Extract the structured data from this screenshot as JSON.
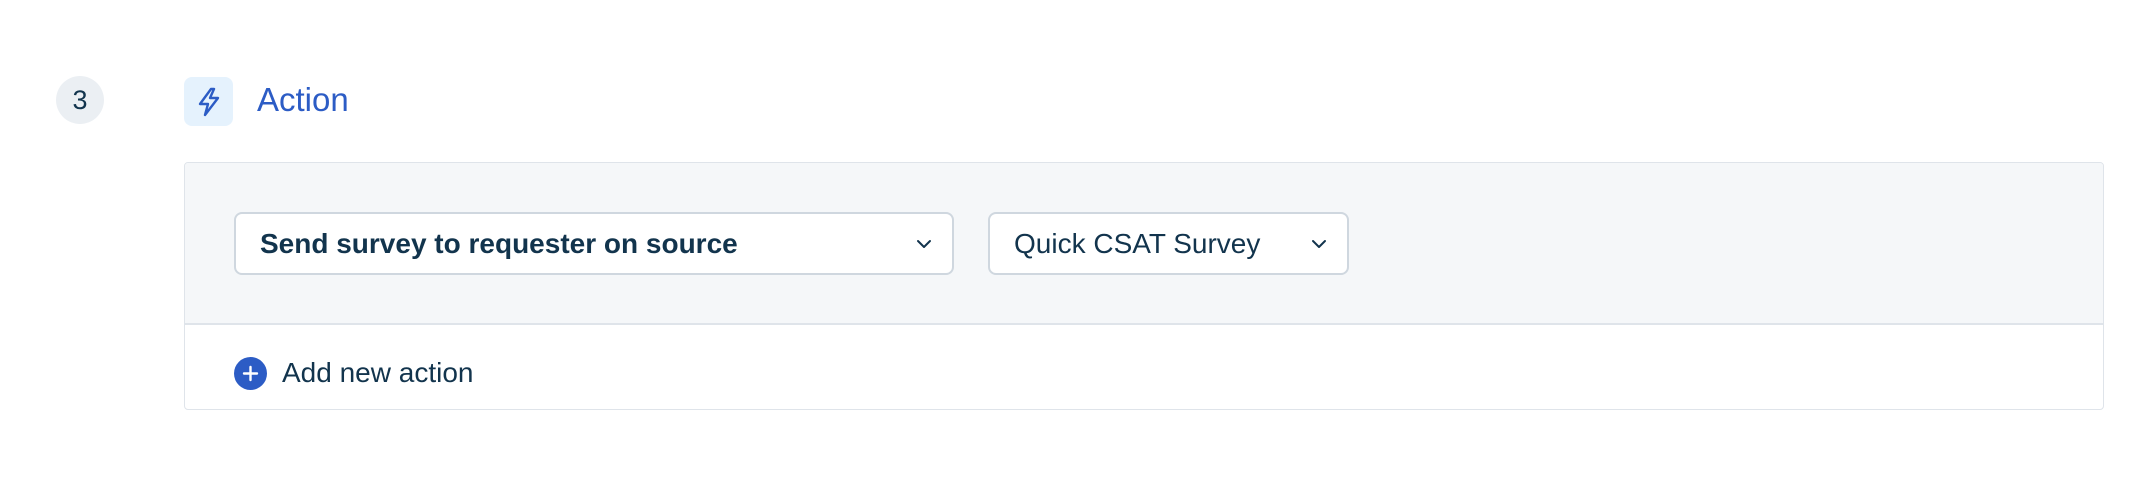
{
  "step": {
    "number": "3",
    "title": "Action",
    "icon": "lightning-bolt-icon",
    "accent_color": "#2c5cc5"
  },
  "actions": [
    {
      "action_select": {
        "value": "Send survey to requester on source"
      },
      "survey_select": {
        "value": "Quick CSAT Survey"
      }
    }
  ],
  "add_action": {
    "label": "Add new action",
    "icon": "plus-circle-icon"
  }
}
